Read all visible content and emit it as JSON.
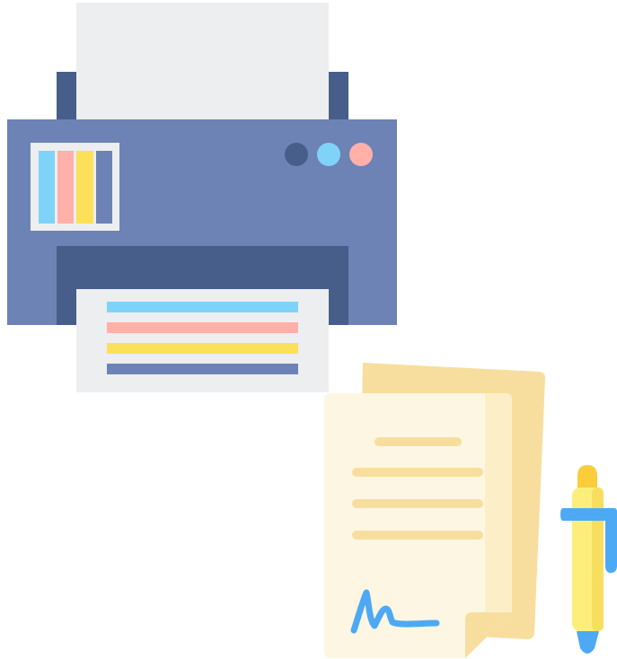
{
  "illustration": {
    "icons": [
      "printer-icon",
      "signed-document-icon",
      "pen-icon"
    ],
    "colors": {
      "paper": "#EDEEF0",
      "printer_body": "#6D82B5",
      "printer_dark": "#465E89",
      "ink_cyan": "#7FD3F8",
      "ink_pink": "#FFB0A9",
      "ink_yellow": "#FCE05A",
      "ink_blue": "#6D82B5",
      "doc_back": "#F8DE9E",
      "doc_front": "#FDF6E2",
      "doc_lines": "#F8DE9E",
      "signature": "#4DA9F3",
      "pen_body": "#FBEE7B",
      "pen_cap": "#FBCD39",
      "pen_clip": "#4DA9F3"
    }
  }
}
